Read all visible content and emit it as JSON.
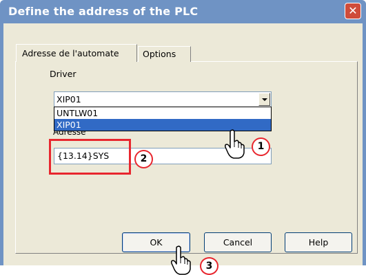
{
  "window": {
    "title": "Define the address of the PLC",
    "close_label": "✕"
  },
  "tabs": [
    {
      "label": "Adresse de l'automate"
    },
    {
      "label": "Options"
    }
  ],
  "driver": {
    "label": "Driver",
    "selected": "XIP01",
    "options": [
      {
        "label": "UNTLW01"
      },
      {
        "label": "XIP01"
      }
    ]
  },
  "address": {
    "label": "Adresse",
    "value": "{13.14}SYS"
  },
  "buttons": {
    "ok": "OK",
    "cancel": "Cancel",
    "help": "Help"
  },
  "steps": {
    "one": "1",
    "two": "2",
    "three": "3"
  },
  "colors": {
    "title_bar": "#6f93c4",
    "selection": "#316ac5",
    "highlight": "#e8262e"
  }
}
